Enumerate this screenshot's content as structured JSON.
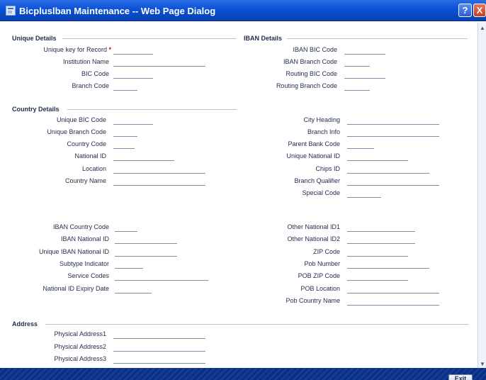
{
  "window": {
    "title": "Bicpluslban Maintenance -- Web Page Dialog",
    "help_symbol": "?",
    "close_symbol": "X"
  },
  "sections": {
    "unique": "Unique Details",
    "iban": "IBAN Details",
    "country": "Country Details",
    "address": "Address"
  },
  "unique_details": [
    {
      "label": "Unique key for Record",
      "required_mark": "*",
      "value": ""
    },
    {
      "label": "Institution Name",
      "value": ""
    },
    {
      "label": "BIC Code",
      "value": ""
    },
    {
      "label": "Branch Code",
      "value": ""
    }
  ],
  "iban_details": [
    {
      "label": "IBAN BIC Code",
      "value": ""
    },
    {
      "label": "IBAN Branch Code",
      "value": ""
    },
    {
      "label": "Routing BIC Code",
      "value": ""
    },
    {
      "label": "Routing Branch Code",
      "value": ""
    }
  ],
  "country_left": [
    {
      "label": "Unique BIC Code",
      "value": ""
    },
    {
      "label": "Unique Branch Code",
      "value": ""
    },
    {
      "label": "Country Code",
      "value": ""
    },
    {
      "label": "National ID",
      "value": ""
    },
    {
      "label": "Location",
      "value": ""
    },
    {
      "label": "Country Name",
      "value": ""
    }
  ],
  "country_right": [
    {
      "label": "City Heading",
      "value": ""
    },
    {
      "label": "Branch Info",
      "value": ""
    },
    {
      "label": "Parent Bank Code",
      "value": ""
    },
    {
      "label": "Unique National ID",
      "value": ""
    },
    {
      "label": "Chips ID",
      "value": ""
    },
    {
      "label": "Branch Qualifier",
      "value": ""
    },
    {
      "label": "Special Code",
      "value": ""
    }
  ],
  "lower_left": [
    {
      "label": "IBAN Country Code",
      "value": ""
    },
    {
      "label": "IBAN National ID",
      "value": ""
    },
    {
      "label": "Unique IBAN National ID",
      "value": ""
    },
    {
      "label": "Subtype Indicator",
      "value": ""
    },
    {
      "label": "Service Codes",
      "value": ""
    },
    {
      "label": "National ID Expiry Date",
      "value": ""
    }
  ],
  "lower_right": [
    {
      "label": "Other National ID1",
      "value": ""
    },
    {
      "label": "Other National ID2",
      "value": ""
    },
    {
      "label": "ZIP Code",
      "value": ""
    },
    {
      "label": "Pob Number",
      "value": ""
    },
    {
      "label": "POB ZIP Code",
      "value": ""
    },
    {
      "label": "POB Location",
      "value": ""
    },
    {
      "label": "Pob Country Name",
      "value": ""
    }
  ],
  "address": [
    {
      "label": "Physical Address1",
      "value": ""
    },
    {
      "label": "Physical Address2",
      "value": ""
    },
    {
      "label": "Physical Address3",
      "value": ""
    }
  ],
  "footer": {
    "exit_label": "Exit"
  },
  "colors": {
    "titlebar": "#0a52d6",
    "footer": "#0b2e7e",
    "required": "#e00000"
  }
}
